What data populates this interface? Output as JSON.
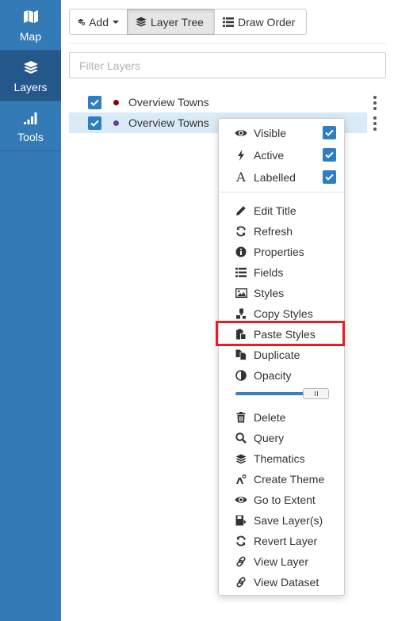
{
  "sidebar": {
    "tabs": [
      {
        "label": "Map",
        "icon": "map-icon"
      },
      {
        "label": "Layers",
        "icon": "layers-icon",
        "active": true
      },
      {
        "label": "Tools",
        "icon": "signal-bars-icon"
      }
    ]
  },
  "toolbar": {
    "add_label": "Add",
    "layer_tree_label": "Layer Tree",
    "draw_order_label": "Draw Order"
  },
  "filter": {
    "placeholder": "Filter Layers",
    "value": ""
  },
  "layers": [
    {
      "name": "Overview Towns",
      "checked": true,
      "dot_color": "#8b0000",
      "selected": false
    },
    {
      "name": "Overview Towns",
      "checked": true,
      "dot_color": "#6a3d9a",
      "selected": true
    }
  ],
  "menu": {
    "toggles": [
      {
        "label": "Visible",
        "icon": "eye-icon",
        "checked": true
      },
      {
        "label": "Active",
        "icon": "bolt-icon",
        "checked": true
      },
      {
        "label": "Labelled",
        "icon": "font-icon",
        "checked": true
      }
    ],
    "items": [
      {
        "label": "Edit Title",
        "icon": "pencil-icon"
      },
      {
        "label": "Refresh",
        "icon": "refresh-icon"
      },
      {
        "label": "Properties",
        "icon": "info-circle-icon"
      },
      {
        "label": "Fields",
        "icon": "list-icon"
      },
      {
        "label": "Styles",
        "icon": "image-icon"
      },
      {
        "label": "Copy Styles",
        "icon": "copy-styles-icon"
      },
      {
        "label": "Paste Styles",
        "icon": "paste-icon"
      },
      {
        "label": "Duplicate",
        "icon": "duplicate-icon"
      },
      {
        "label": "Opacity",
        "icon": "contrast-icon"
      }
    ],
    "opacity_level": 1.0,
    "items2": [
      {
        "label": "Delete",
        "icon": "trash-icon"
      },
      {
        "label": "Query",
        "icon": "search-icon"
      },
      {
        "label": "Thematics",
        "icon": "layers-icon"
      },
      {
        "label": "Create Theme",
        "icon": "create-theme-icon"
      },
      {
        "label": "Go to Extent",
        "icon": "eye-icon"
      },
      {
        "label": "Save Layer(s)",
        "icon": "save-icon"
      },
      {
        "label": "Revert Layer",
        "icon": "refresh-icon"
      },
      {
        "label": "View Layer",
        "icon": "link-icon"
      },
      {
        "label": "View Dataset",
        "icon": "link-icon"
      }
    ],
    "highlighted_item": "Paste Styles"
  },
  "colors": {
    "sidebar": "#337ab7",
    "sidebar_active": "#24588a",
    "checkbox": "#2f7dc3",
    "selected_row": "#d9ebf7",
    "highlight": "#e31e26"
  }
}
